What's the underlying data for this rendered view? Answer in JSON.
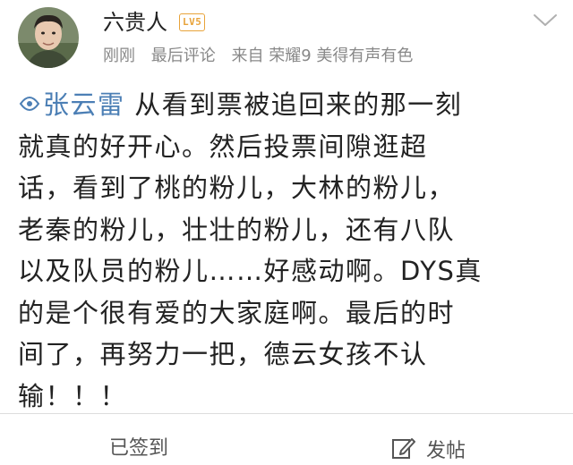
{
  "post": {
    "author": "六贵人",
    "badge": "LV5",
    "time": "刚刚",
    "comment_status": "最后评论",
    "source": "来自 荣耀9 美得有声有色",
    "topic": "张云雷",
    "lines": [
      "从看到票被追回来的那一刻",
      "就真的好开心。然后投票间隙逛超",
      "话，看到了桃的粉儿，大林的粉儿，",
      "老秦的粉儿，壮壮的粉儿，还有八队",
      "以及队员的粉儿……好感动啊。DYS真",
      "的是个很有爱的大家庭啊。最后的时",
      "间了，再努力一把，德云女孩不认",
      "输！！！"
    ]
  },
  "footer": {
    "checkin_label": "已签到",
    "post_label": "发帖"
  },
  "colors": {
    "topic": "#4c7fb5",
    "badge": "#e8a33a",
    "meta": "#888888"
  },
  "icons": {
    "topic": "topic-icon",
    "chevron": "chevron-down-icon",
    "post": "edit-icon"
  }
}
